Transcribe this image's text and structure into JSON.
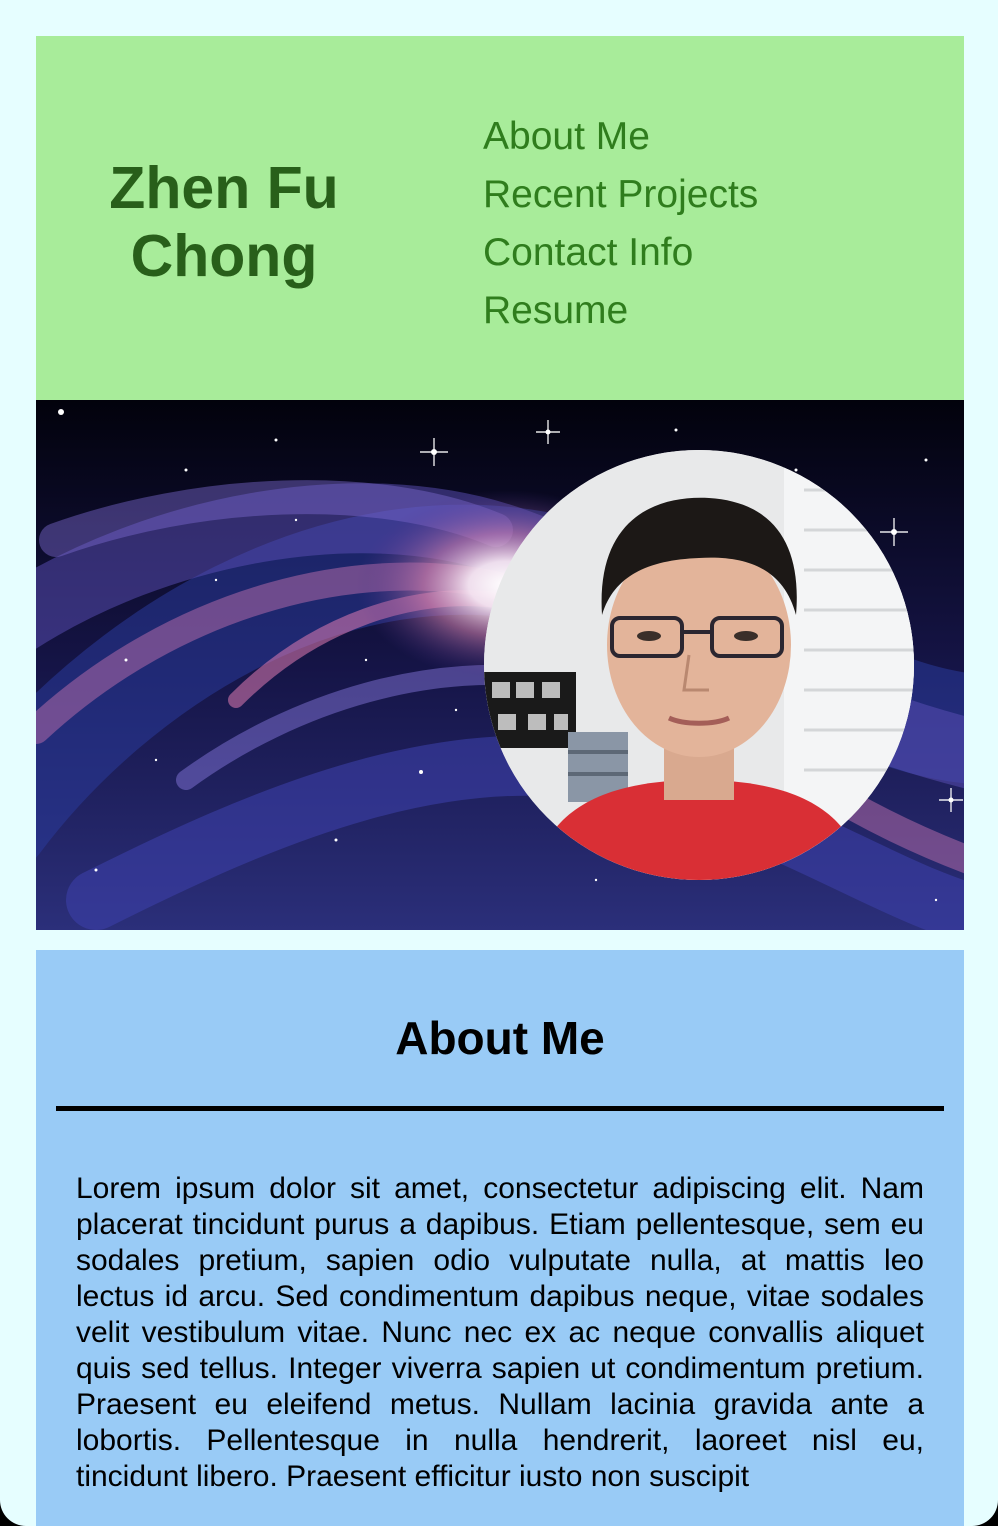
{
  "header": {
    "name_line1": "Zhen Fu",
    "name_line2": "Chong",
    "nav": [
      {
        "label": "About Me"
      },
      {
        "label": "Recent Projects"
      },
      {
        "label": "Contact Info"
      },
      {
        "label": "Resume"
      }
    ]
  },
  "hero": {
    "background": "galaxy-image",
    "portrait": "profile-photo"
  },
  "about": {
    "heading": "About Me",
    "body": "Lorem ipsum dolor sit amet, consectetur adipiscing elit. Nam placerat tincidunt purus a dapibus. Etiam pellentesque, sem eu sodales pretium, sapien odio vulputate nulla, at mattis leo lectus id arcu. Sed condimentum dapibus neque, vitae sodales velit vestibulum vitae. Nunc nec ex ac neque convallis aliquet quis sed tellus. Integer viverra sapien ut condimentum pretium. Praesent eu eleifend metus. Nullam lacinia gravida ante a lobortis. Pellentesque in nulla hendrerit, laoreet nisl eu, tincidunt libero. Praesent efficitur iusto non suscipit"
  },
  "colors": {
    "page_background": "#e6feff",
    "header_background": "#a8ec9a",
    "title_color": "#285f1a",
    "nav_color": "#2f7d1d",
    "about_background": "#99cbf6"
  }
}
